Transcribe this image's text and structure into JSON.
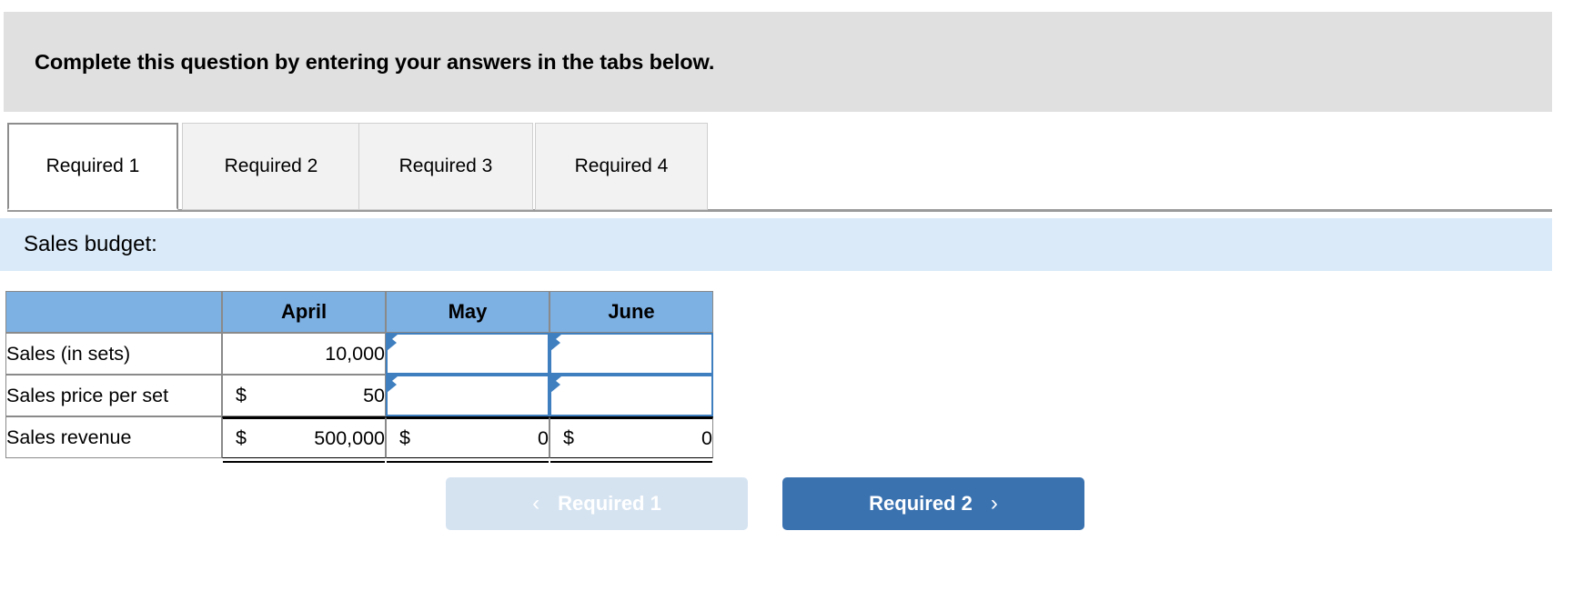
{
  "instruction": {
    "text": "Complete this question by entering your answers in the tabs below."
  },
  "tabs": {
    "items": [
      {
        "label": "Required 1",
        "active": true
      },
      {
        "label": "Required 2",
        "active": false
      },
      {
        "label": "Required 3",
        "active": false
      },
      {
        "label": "Required 4",
        "active": false
      }
    ]
  },
  "section": {
    "title": "Sales budget:"
  },
  "table": {
    "corner_header": "",
    "column_headers": [
      "April",
      "May",
      "June"
    ],
    "rows": [
      {
        "label": "Sales (in sets)",
        "april": {
          "symbol": "",
          "value": "10,000",
          "editable": false
        },
        "may": {
          "symbol": "",
          "value": "",
          "editable": true
        },
        "june": {
          "symbol": "",
          "value": "",
          "editable": true
        }
      },
      {
        "label": "Sales price per set",
        "april": {
          "symbol": "$",
          "value": "50",
          "editable": false
        },
        "may": {
          "symbol": "",
          "value": "",
          "editable": true
        },
        "june": {
          "symbol": "",
          "value": "",
          "editable": true
        }
      },
      {
        "label": "Sales revenue",
        "april": {
          "symbol": "$",
          "value": "500,000",
          "editable": false
        },
        "may": {
          "symbol": "$",
          "value": "0",
          "editable": false
        },
        "june": {
          "symbol": "$",
          "value": "0",
          "editable": false
        }
      }
    ]
  },
  "navigation": {
    "prev_label": "Required 1",
    "prev_icon": "chevron-left-icon",
    "prev_glyph": "‹",
    "next_label": "Required 2",
    "next_icon": "chevron-right-icon",
    "next_glyph": "›"
  },
  "colors": {
    "banner_bg": "#e0e0e0",
    "section_bg": "#daeaf8",
    "table_header_bg": "#7db0e3",
    "input_border": "#3f7fc0",
    "next_button_bg": "#3a72b0",
    "prev_button_bg": "#d5e3f1"
  }
}
